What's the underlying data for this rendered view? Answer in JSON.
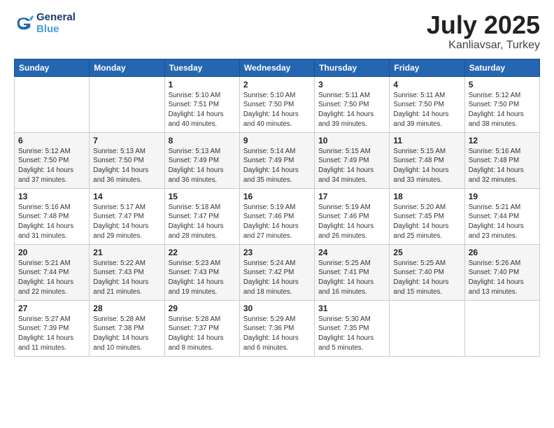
{
  "logo": {
    "line1": "General",
    "line2": "Blue"
  },
  "title": "July 2025",
  "location": "Kanliavsar, Turkey",
  "days_of_week": [
    "Sunday",
    "Monday",
    "Tuesday",
    "Wednesday",
    "Thursday",
    "Friday",
    "Saturday"
  ],
  "weeks": [
    [
      {
        "day": "",
        "info": ""
      },
      {
        "day": "",
        "info": ""
      },
      {
        "day": "1",
        "info": "Sunrise: 5:10 AM\nSunset: 7:51 PM\nDaylight: 14 hours\nand 40 minutes."
      },
      {
        "day": "2",
        "info": "Sunrise: 5:10 AM\nSunset: 7:50 PM\nDaylight: 14 hours\nand 40 minutes."
      },
      {
        "day": "3",
        "info": "Sunrise: 5:11 AM\nSunset: 7:50 PM\nDaylight: 14 hours\nand 39 minutes."
      },
      {
        "day": "4",
        "info": "Sunrise: 5:11 AM\nSunset: 7:50 PM\nDaylight: 14 hours\nand 39 minutes."
      },
      {
        "day": "5",
        "info": "Sunrise: 5:12 AM\nSunset: 7:50 PM\nDaylight: 14 hours\nand 38 minutes."
      }
    ],
    [
      {
        "day": "6",
        "info": "Sunrise: 5:12 AM\nSunset: 7:50 PM\nDaylight: 14 hours\nand 37 minutes."
      },
      {
        "day": "7",
        "info": "Sunrise: 5:13 AM\nSunset: 7:50 PM\nDaylight: 14 hours\nand 36 minutes."
      },
      {
        "day": "8",
        "info": "Sunrise: 5:13 AM\nSunset: 7:49 PM\nDaylight: 14 hours\nand 36 minutes."
      },
      {
        "day": "9",
        "info": "Sunrise: 5:14 AM\nSunset: 7:49 PM\nDaylight: 14 hours\nand 35 minutes."
      },
      {
        "day": "10",
        "info": "Sunrise: 5:15 AM\nSunset: 7:49 PM\nDaylight: 14 hours\nand 34 minutes."
      },
      {
        "day": "11",
        "info": "Sunrise: 5:15 AM\nSunset: 7:48 PM\nDaylight: 14 hours\nand 33 minutes."
      },
      {
        "day": "12",
        "info": "Sunrise: 5:16 AM\nSunset: 7:48 PM\nDaylight: 14 hours\nand 32 minutes."
      }
    ],
    [
      {
        "day": "13",
        "info": "Sunrise: 5:16 AM\nSunset: 7:48 PM\nDaylight: 14 hours\nand 31 minutes."
      },
      {
        "day": "14",
        "info": "Sunrise: 5:17 AM\nSunset: 7:47 PM\nDaylight: 14 hours\nand 29 minutes."
      },
      {
        "day": "15",
        "info": "Sunrise: 5:18 AM\nSunset: 7:47 PM\nDaylight: 14 hours\nand 28 minutes."
      },
      {
        "day": "16",
        "info": "Sunrise: 5:19 AM\nSunset: 7:46 PM\nDaylight: 14 hours\nand 27 minutes."
      },
      {
        "day": "17",
        "info": "Sunrise: 5:19 AM\nSunset: 7:46 PM\nDaylight: 14 hours\nand 26 minutes."
      },
      {
        "day": "18",
        "info": "Sunrise: 5:20 AM\nSunset: 7:45 PM\nDaylight: 14 hours\nand 25 minutes."
      },
      {
        "day": "19",
        "info": "Sunrise: 5:21 AM\nSunset: 7:44 PM\nDaylight: 14 hours\nand 23 minutes."
      }
    ],
    [
      {
        "day": "20",
        "info": "Sunrise: 5:21 AM\nSunset: 7:44 PM\nDaylight: 14 hours\nand 22 minutes."
      },
      {
        "day": "21",
        "info": "Sunrise: 5:22 AM\nSunset: 7:43 PM\nDaylight: 14 hours\nand 21 minutes."
      },
      {
        "day": "22",
        "info": "Sunrise: 5:23 AM\nSunset: 7:43 PM\nDaylight: 14 hours\nand 19 minutes."
      },
      {
        "day": "23",
        "info": "Sunrise: 5:24 AM\nSunset: 7:42 PM\nDaylight: 14 hours\nand 18 minutes."
      },
      {
        "day": "24",
        "info": "Sunrise: 5:25 AM\nSunset: 7:41 PM\nDaylight: 14 hours\nand 16 minutes."
      },
      {
        "day": "25",
        "info": "Sunrise: 5:25 AM\nSunset: 7:40 PM\nDaylight: 14 hours\nand 15 minutes."
      },
      {
        "day": "26",
        "info": "Sunrise: 5:26 AM\nSunset: 7:40 PM\nDaylight: 14 hours\nand 13 minutes."
      }
    ],
    [
      {
        "day": "27",
        "info": "Sunrise: 5:27 AM\nSunset: 7:39 PM\nDaylight: 14 hours\nand 11 minutes."
      },
      {
        "day": "28",
        "info": "Sunrise: 5:28 AM\nSunset: 7:38 PM\nDaylight: 14 hours\nand 10 minutes."
      },
      {
        "day": "29",
        "info": "Sunrise: 5:28 AM\nSunset: 7:37 PM\nDaylight: 14 hours\nand 8 minutes."
      },
      {
        "day": "30",
        "info": "Sunrise: 5:29 AM\nSunset: 7:36 PM\nDaylight: 14 hours\nand 6 minutes."
      },
      {
        "day": "31",
        "info": "Sunrise: 5:30 AM\nSunset: 7:35 PM\nDaylight: 14 hours\nand 5 minutes."
      },
      {
        "day": "",
        "info": ""
      },
      {
        "day": "",
        "info": ""
      }
    ]
  ]
}
